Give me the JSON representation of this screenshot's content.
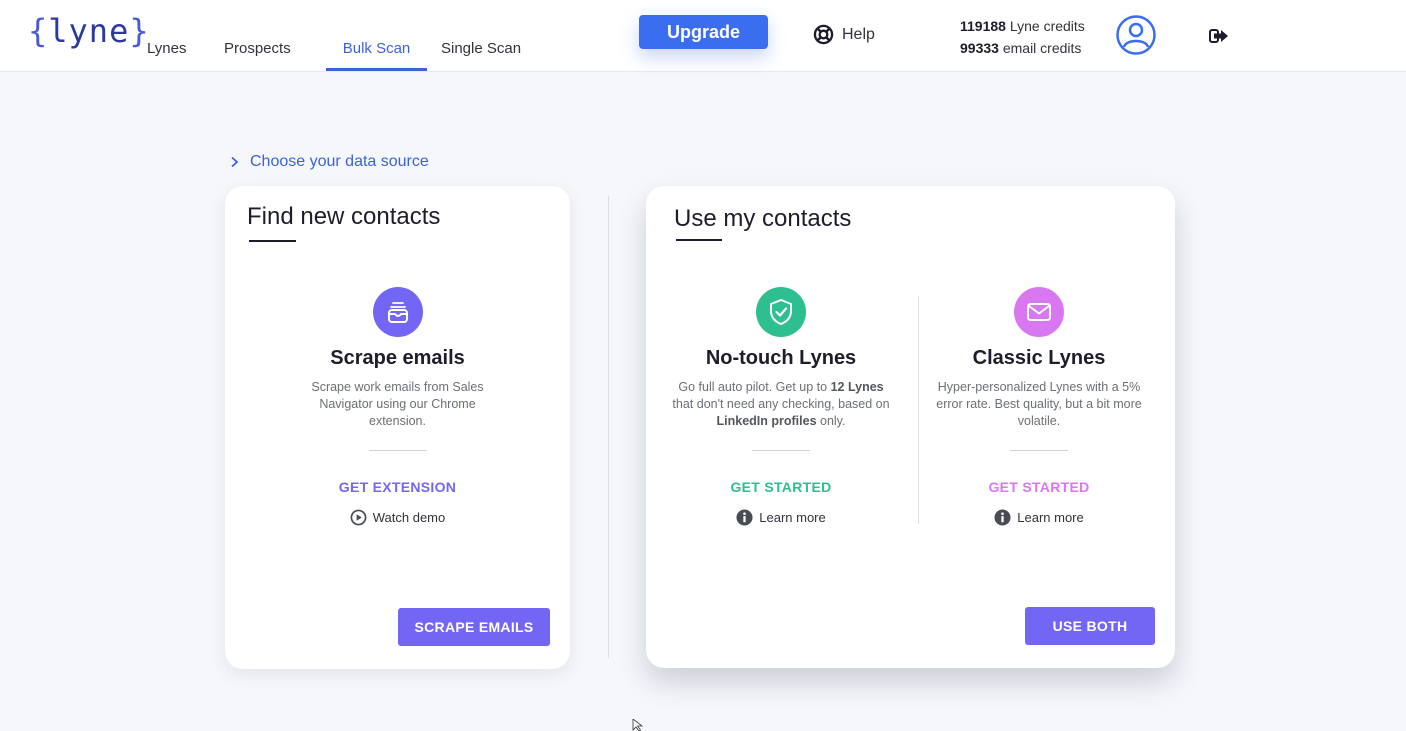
{
  "header": {
    "logo_brace_open": "{",
    "logo_word": "lyne",
    "logo_brace_close": "}",
    "tabs": [
      {
        "label": "Lynes",
        "active": false
      },
      {
        "label": "Prospects",
        "active": false
      },
      {
        "label": "Bulk Scan",
        "active": true
      },
      {
        "label": "Single Scan",
        "active": false
      }
    ],
    "upgrade_label": "Upgrade",
    "help_label": "Help",
    "help_icon": "lifebuoy-icon",
    "credits": {
      "lyne_value": "119188",
      "lyne_label": "Lyne credits",
      "email_value": "99333",
      "email_label": "email credits"
    },
    "avatar_icon": "user-avatar-icon",
    "logout_icon": "logout-icon",
    "accent_color": "#3a6df0"
  },
  "section": {
    "breadcrumb_label": "Choose your data source",
    "breadcrumb_icon": "chevron-right-icon"
  },
  "find_card": {
    "title": "Find new contacts",
    "option": {
      "icon": "inbox-icon",
      "icon_color": "#7466f5",
      "title": "Scrape emails",
      "description": "Scrape work emails from Sales Navigator using our Chrome extension.",
      "cta": "GET EXTENSION",
      "cta_color": "#7466f5",
      "link_label": "Watch demo",
      "link_icon": "play-circle-icon"
    },
    "button_label": "SCRAPE EMAILS"
  },
  "use_card": {
    "title": "Use my contacts",
    "options": [
      {
        "icon": "shield-check-icon",
        "icon_color": "#2dbf8f",
        "title": "No-touch Lynes",
        "desc_part1": "Go full auto pilot. Get up to ",
        "desc_bold1": "12 Lynes",
        "desc_part2": " that don't need any checking, based on ",
        "desc_bold2": "LinkedIn profiles",
        "desc_part3": " only.",
        "cta": "GET STARTED",
        "cta_color": "#2dbf8f",
        "link_label": "Learn more",
        "link_icon": "info-circle-icon"
      },
      {
        "icon": "envelope-icon",
        "icon_color": "#d877f0",
        "title": "Classic Lynes",
        "description": "Hyper-personalized Lynes with a 5% error rate. Best quality, but a bit more volatile.",
        "cta": "GET STARTED",
        "cta_color": "#d877f0",
        "link_label": "Learn more",
        "link_icon": "info-circle-icon"
      }
    ],
    "button_label": "USE BOTH"
  }
}
